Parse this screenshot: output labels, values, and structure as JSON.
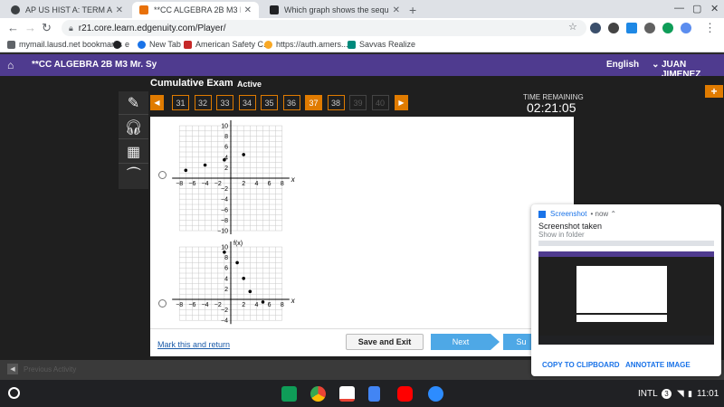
{
  "browser": {
    "tabs": [
      {
        "title": "AP US HIST A: TERM A3- PERIOD",
        "active": false
      },
      {
        "title": "**CC ALGEBRA 2B M3 Mr. Sy - Ed",
        "active": true
      },
      {
        "title": "Which graph shows the sequenc",
        "active": false
      }
    ],
    "url": "r21.core.learn.edgenuity.com/Player/",
    "bookmarks": [
      "mymail.lausd.net bookmarks",
      "e",
      "New Tab",
      "American Safety C...",
      "https://auth.amers...",
      "Savvas Realize"
    ]
  },
  "app": {
    "course_title": "**CC ALGEBRA 2B M3 Mr. Sy",
    "language": "English",
    "user": "JUAN JIMENEZ"
  },
  "exam": {
    "title": "Cumulative Exam",
    "status": "Active",
    "questions": [
      "31",
      "32",
      "33",
      "34",
      "35",
      "36",
      "37",
      "38",
      "39",
      "40"
    ],
    "current": "37",
    "time_label": "TIME REMAINING",
    "time_value": "02:21:05"
  },
  "graph_a": {
    "y_ticks": [
      "10",
      "8",
      "6",
      "4",
      "2",
      "-2",
      "-4",
      "-6",
      "-8",
      "-10"
    ],
    "x_ticks": [
      "-8",
      "-6",
      "-4",
      "-2",
      "2",
      "4",
      "6",
      "8"
    ],
    "x_label": "x",
    "points": [
      [
        -7,
        1.5
      ],
      [
        -4,
        2.5
      ],
      [
        -1,
        3.5
      ],
      [
        2,
        4.5
      ]
    ]
  },
  "graph_b": {
    "y_label": "f(x)",
    "y_ticks": [
      "10",
      "8",
      "6",
      "4",
      "2",
      "-2",
      "-4"
    ],
    "x_ticks": [
      "-8",
      "-6",
      "-4",
      "-2",
      "2",
      "4",
      "6",
      "8"
    ],
    "x_label": "x",
    "points": [
      [
        -1,
        9
      ],
      [
        1,
        7
      ],
      [
        2,
        4
      ],
      [
        3,
        1.5
      ],
      [
        5,
        -0.5
      ]
    ]
  },
  "footer": {
    "mark_return": "Mark this and return",
    "save_exit": "Save and Exit",
    "next": "Next",
    "submit": "Su"
  },
  "bottom": {
    "previous_activity": "Previous Activity"
  },
  "notification": {
    "app": "Screenshot",
    "time": "• now ⌃",
    "title": "Screenshot taken",
    "subtitle": "Show in folder",
    "copy": "COPY TO CLIPBOARD",
    "annotate": "ANNOTATE IMAGE"
  },
  "tray": {
    "input": "INTL",
    "badge": "3",
    "time": "11:01"
  },
  "colors": {
    "header": "#4f3b8f",
    "accent": "#e07b00",
    "next_button": "#4ea8e6"
  }
}
